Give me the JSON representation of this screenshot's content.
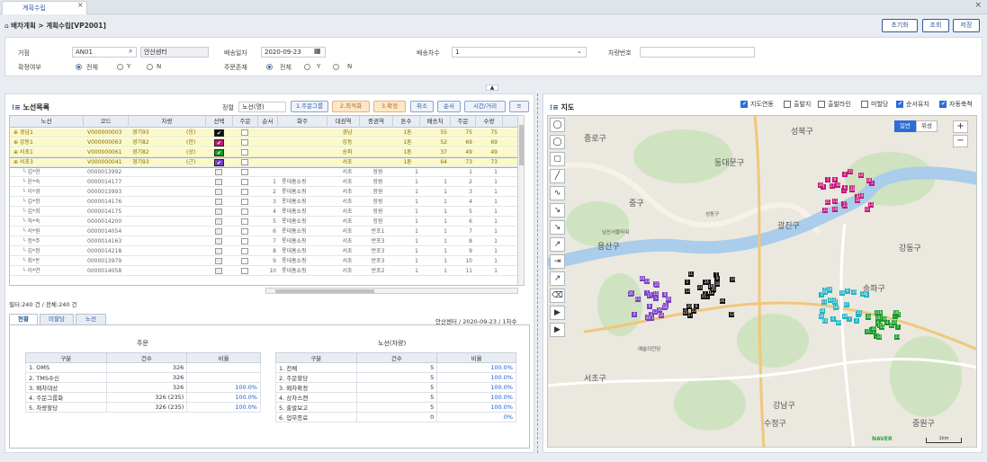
{
  "tab": {
    "title": "계획수립",
    "close": "×"
  },
  "closeall": "×",
  "breadcrumb": {
    "path": "배차계획 > 계획수립[VP2001]"
  },
  "top_buttons": {
    "reset": "초기화",
    "search": "조회",
    "save": "저장"
  },
  "filters": {
    "center_label": "거점",
    "center_code": "AN01",
    "center_name": "안산센터",
    "date_label": "배송일자",
    "date_value": "2020-09-23",
    "round_label": "배송차수",
    "round_value": "1",
    "vehicle_label": "차량번호",
    "vehicle_value": "",
    "confirm_label": "확정여부",
    "order_label": "주문존재",
    "radio_all": "전체",
    "radio_y": "Y",
    "radio_n": "N"
  },
  "left_panel": {
    "title": "노선목록",
    "sort_label": "정렬",
    "sort_value": "노선(명)",
    "buttons": {
      "order_group": "1.주문그룹",
      "optimize": "2.최적화",
      "confirm": "3.확정",
      "cancel": "취소",
      "sequence": "순서",
      "time_distance": "시간/거리"
    },
    "columns": [
      "노선",
      "코드",
      "차량",
      "선택",
      "주문",
      "순서",
      "화주",
      "대권역",
      "중권역",
      "톤수",
      "배송처",
      "주문",
      "수량"
    ],
    "route_rows": [
      {
        "name": "경남1",
        "code": "V000000003",
        "vehicle": "경기93",
        "tag": "(응)",
        "color": "#111111",
        "region": "경남",
        "mid": "",
        "ton": "1톤",
        "dest": "55",
        "order": "75",
        "qty": "75"
      },
      {
        "name": "강동1",
        "code": "V000000063",
        "vehicle": "경기82",
        "tag": "(한)",
        "color": "#c2187a",
        "region": "강동",
        "mid": "",
        "ton": "1톤",
        "dest": "52",
        "order": "69",
        "qty": "69"
      },
      {
        "name": "서초1",
        "code": "V000000061",
        "vehicle": "경기82",
        "tag": "(상)",
        "color": "#1a9a2a",
        "region": "송파",
        "mid": "",
        "ton": "1톤",
        "dest": "37",
        "order": "49",
        "qty": "49"
      },
      {
        "name": "서초3",
        "code": "V000000041",
        "vehicle": "경기93",
        "tag": "(근)",
        "color": "#7b3fc4",
        "region": "서초",
        "mid": "",
        "ton": "1톤",
        "dest": "64",
        "order": "73",
        "qty": "73"
      }
    ],
    "order_rows": [
      {
        "name": "김*현",
        "code": "0000013992",
        "seq": "",
        "shipper": "",
        "region": "서초",
        "mid": "장원",
        "ton": "1",
        "dest": "",
        "order": "1",
        "qty": "1"
      },
      {
        "name": "윤*숙",
        "code": "0000014177",
        "seq": "1",
        "shipper": "롯데홈쇼핑",
        "region": "서초",
        "mid": "장원",
        "ton": "1",
        "dest": "1",
        "order": "2",
        "qty": "1"
      },
      {
        "name": "이*경",
        "code": "0000013993",
        "seq": "2",
        "shipper": "롯데홈쇼핑",
        "region": "서초",
        "mid": "장원",
        "ton": "1",
        "dest": "1",
        "order": "3",
        "qty": "1"
      },
      {
        "name": "김*정",
        "code": "0000014176",
        "seq": "3",
        "shipper": "롯데홈쇼핑",
        "region": "서초",
        "mid": "장원",
        "ton": "1",
        "dest": "1",
        "order": "4",
        "qty": "1"
      },
      {
        "name": "김*희",
        "code": "0000014175",
        "seq": "4",
        "shipper": "롯데홈쇼핑",
        "region": "서초",
        "mid": "장원",
        "ton": "1",
        "dest": "1",
        "order": "5",
        "qty": "1"
      },
      {
        "name": "하*숙",
        "code": "0000014200",
        "seq": "5",
        "shipper": "롯데홈쇼핑",
        "region": "서초",
        "mid": "장원",
        "ton": "1",
        "dest": "1",
        "order": "6",
        "qty": "1"
      },
      {
        "name": "서*원",
        "code": "0000014054",
        "seq": "6",
        "shipper": "롯데홈쇼핑",
        "region": "서초",
        "mid": "반포1",
        "ton": "1",
        "dest": "1",
        "order": "7",
        "qty": "1"
      },
      {
        "name": "정*주",
        "code": "0000014163",
        "seq": "7",
        "shipper": "롯데홈쇼핑",
        "region": "서초",
        "mid": "반포3",
        "ton": "1",
        "dest": "1",
        "order": "8",
        "qty": "1"
      },
      {
        "name": "김*정",
        "code": "0000014218",
        "seq": "8",
        "shipper": "롯데홈쇼핑",
        "region": "서초",
        "mid": "반포3",
        "ton": "1",
        "dest": "1",
        "order": "9",
        "qty": "1"
      },
      {
        "name": "최*돈",
        "code": "0000013979",
        "seq": "9",
        "shipper": "롯데홈쇼핑",
        "region": "서초",
        "mid": "반포3",
        "ton": "1",
        "dest": "1",
        "order": "10",
        "qty": "1"
      },
      {
        "name": "이*연",
        "code": "0000014058",
        "seq": "10",
        "shipper": "롯데홈쇼핑",
        "region": "서초",
        "mid": "반포2",
        "ton": "1",
        "dest": "1",
        "order": "11",
        "qty": "1"
      }
    ],
    "summary": "필터:240 건 / 전체:240 건"
  },
  "bottom": {
    "tabs": [
      "현황",
      "미할당",
      "노선"
    ],
    "info": "안산센터 / 2020-09-23 / 1차수",
    "order_title": "주문",
    "route_title": "노선(차량)",
    "headers": [
      "구분",
      "건수",
      "비율"
    ],
    "order_rows": [
      {
        "label": "1. OMS",
        "count": "326",
        "ratio": ""
      },
      {
        "label": "2. TMS수신",
        "count": "326",
        "ratio": ""
      },
      {
        "label": "3. 배차대상",
        "count": "326",
        "ratio": "100.0%"
      },
      {
        "label": "4. 주문그룹화",
        "count": "326 (235)",
        "ratio": "100.0%"
      },
      {
        "label": "5. 차량할당",
        "count": "326 (235)",
        "ratio": "100.0%"
      }
    ],
    "route_rows": [
      {
        "label": "1. 전체",
        "count": "5",
        "ratio": "100.0%"
      },
      {
        "label": "2. 주문할당",
        "count": "5",
        "ratio": "100.0%"
      },
      {
        "label": "3. 배차확정",
        "count": "5",
        "ratio": "100.0%"
      },
      {
        "label": "4. 상차스캔",
        "count": "5",
        "ratio": "100.0%"
      },
      {
        "label": "5. 출발보고",
        "count": "5",
        "ratio": "100.0%"
      },
      {
        "label": "6. 업무종료",
        "count": "0",
        "ratio": "0%"
      }
    ]
  },
  "map_panel": {
    "title": "지도",
    "toggles": [
      "지도연동",
      "출발지",
      "출발라인",
      "미할당",
      "순서유지",
      "자동축척"
    ],
    "toggle_on": [
      true,
      false,
      false,
      false,
      true,
      true
    ],
    "type_normal": "일반",
    "type_sat": "위성",
    "labels": [
      "종로구",
      "동대문구",
      "성북구",
      "광진구",
      "중구",
      "용산구",
      "남산서울타워",
      "성동구",
      "강남구",
      "서초구",
      "송파구",
      "강동구",
      "수정구",
      "중원구",
      "예술의전당"
    ],
    "scale": "1km",
    "brand": "NAVER"
  }
}
